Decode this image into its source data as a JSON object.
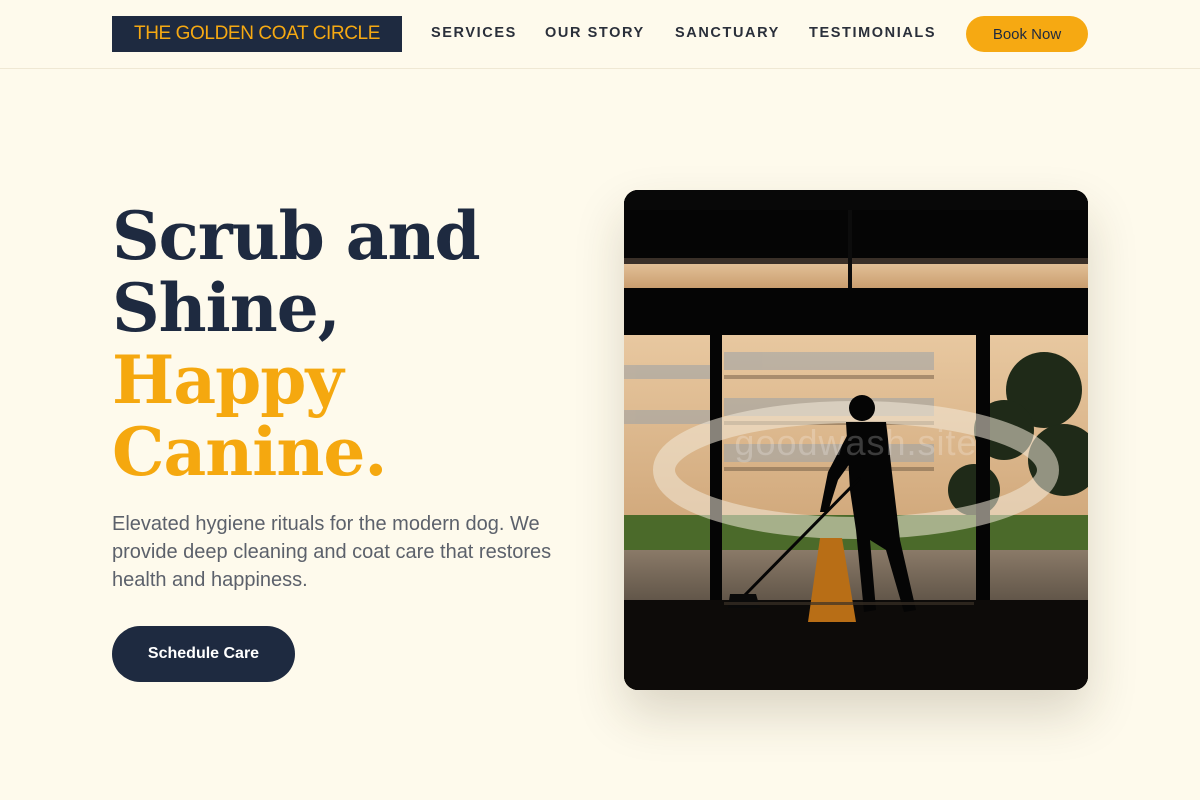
{
  "header": {
    "logo_text": "THE GOLDEN COAT CIRCLE",
    "nav": [
      "SERVICES",
      "OUR STORY",
      "SANCTUARY",
      "TESTIMONIALS"
    ],
    "book_label": "Book Now"
  },
  "hero": {
    "headline_line1": "Scrub and",
    "headline_line2": "Shine,",
    "headline_line3": "Happy",
    "headline_line4": "Canine.",
    "lead": "Elevated hygiene rituals for the modern dog. We provide deep cleaning and coat care that restores health and happiness.",
    "cta_label": "Schedule Care",
    "image_watermark": "goodwash.site"
  },
  "colors": {
    "background": "#fefaec",
    "navy": "#1e2a40",
    "gold": "#f5a80f",
    "body_text": "#5c616b"
  }
}
